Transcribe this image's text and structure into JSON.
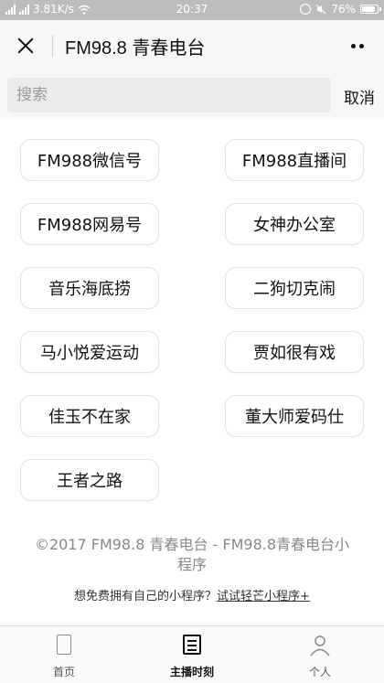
{
  "status_bar": {
    "signal1": "4G",
    "speed": "3.81K/s",
    "time": "20:37",
    "battery": "76%",
    "battery_fraction": 0.76
  },
  "nav": {
    "title": "FM98.8 青春电台"
  },
  "search": {
    "placeholder": "搜索",
    "cancel_label": "取消"
  },
  "channels": [
    "FM988微信号",
    "FM988直播间",
    "FM988网易号",
    "女神办公室",
    "音乐海底捞",
    "二狗切克闹",
    "马小悦爱运动",
    "贾如很有戏",
    "佳玉不在家",
    "董大师爱码仕",
    "王者之路"
  ],
  "footer": {
    "copyright": "©2017 FM98.8 青春电台 - FM98.8青春电台小程序",
    "promo_text": "想免费拥有自己的小程序？",
    "promo_link": "试试轻芒小程序+"
  },
  "tabbar": {
    "tabs": [
      {
        "label": "首页",
        "icon": "page-icon"
      },
      {
        "label": "主播时刻",
        "icon": "list-icon"
      },
      {
        "label": "个人",
        "icon": "person-icon"
      }
    ],
    "active_index": 1
  },
  "colors": {
    "status_bar": "#bdbdbd",
    "nav_bg": "#f7f7f7",
    "search_bg": "#ebebeb",
    "chip_border": "#e3e3e3"
  }
}
